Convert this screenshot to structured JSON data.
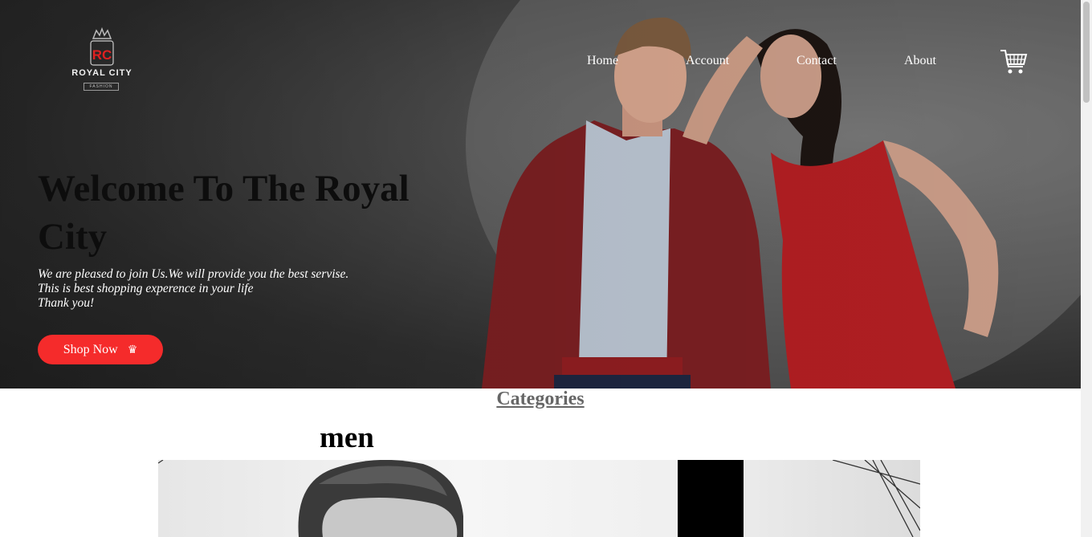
{
  "brand": {
    "logo_text": "ROYAL CITY",
    "logo_subtext": "FASHION",
    "logo_monogram": "RC"
  },
  "nav": {
    "items": [
      {
        "label": "Home"
      },
      {
        "label": "Account"
      },
      {
        "label": "Contact"
      },
      {
        "label": "About"
      }
    ],
    "cart_icon": "shopping-cart-icon"
  },
  "hero": {
    "title": "Welcome To The Royal City",
    "lines": [
      "We are pleased to join Us.We will provide you the best servise.",
      "This is best shopping experence in your life",
      "Thank you!"
    ],
    "button_label": "Shop Now",
    "button_icon": "crown-icon",
    "button_icon_glyph": "♛",
    "accent_color": "#f52b2b"
  },
  "categories": {
    "heading": "Categories",
    "items": [
      {
        "name": "men"
      }
    ]
  }
}
